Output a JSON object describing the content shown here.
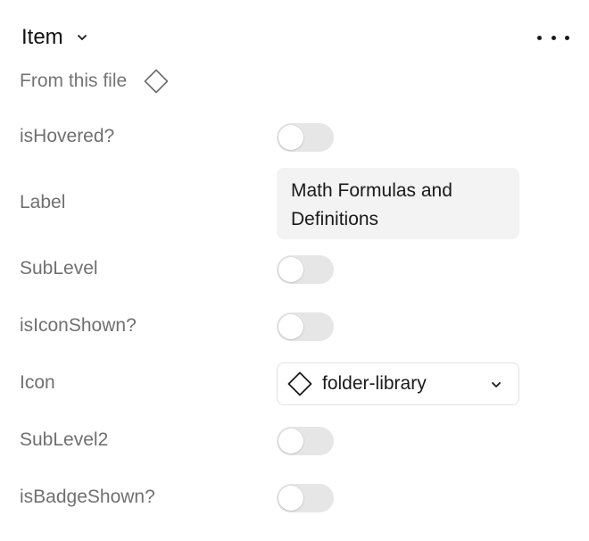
{
  "panel": {
    "title": "Item",
    "source_label": "From this file",
    "icons": {
      "title_dropdown": "chevron-down-icon",
      "more": "more-horizontal-icon",
      "source": "component-diamond-icon"
    }
  },
  "properties": {
    "is_hovered": {
      "label": "isHovered?",
      "value": false
    },
    "label": {
      "label": "Label",
      "value": "Math Formulas and Definitions"
    },
    "sub_level": {
      "label": "SubLevel",
      "value": false
    },
    "is_icon_shown": {
      "label": "isIconShown?",
      "value": false
    },
    "icon": {
      "label": "Icon",
      "value": "folder-library",
      "icon": "component-diamond-icon"
    },
    "sub_level2": {
      "label": "SubLevel2",
      "value": false
    },
    "is_badge_shown": {
      "label": "isBadgeShown?",
      "value": false
    }
  },
  "colors": {
    "toggle_off": "#e6e6e6",
    "label_text": "#707070",
    "input_bg": "#f3f3f3"
  }
}
